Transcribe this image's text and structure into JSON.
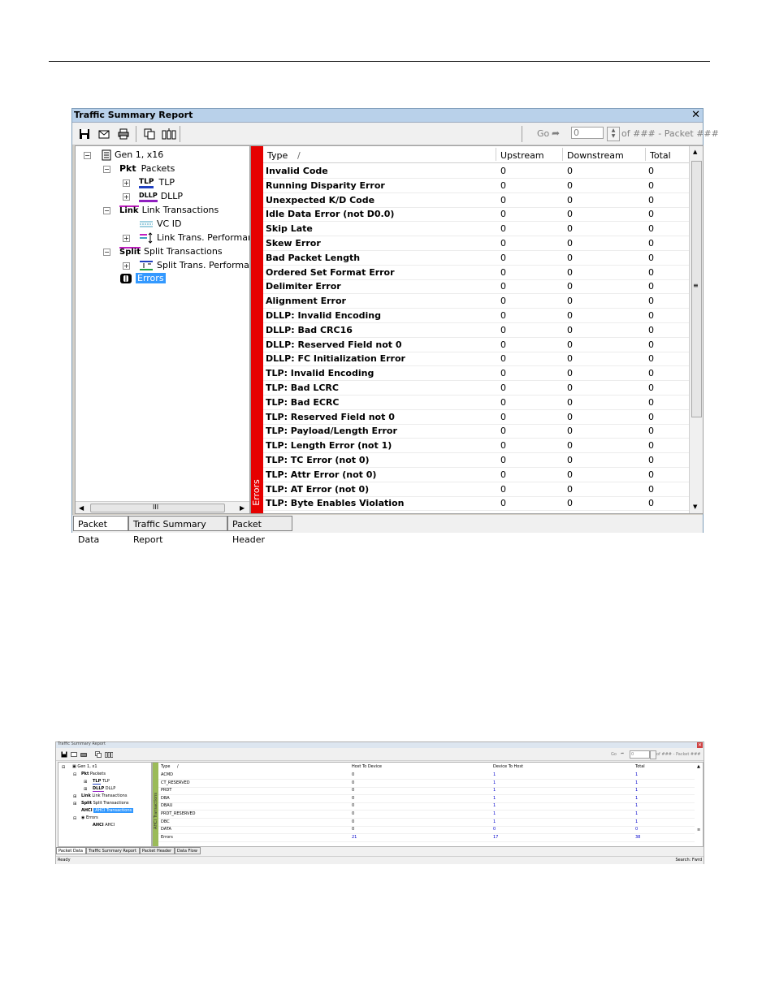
{
  "window1": {
    "title": "Traffic Summary Report",
    "close": "✕",
    "toolbar": {
      "go_label": "Go",
      "packet_input": "0",
      "of_label": "of ### - Packet ###"
    },
    "tree": {
      "root": "Gen 1, x16",
      "packets": "Packets",
      "packets_icon": "Pkt",
      "tlp": "TLP",
      "tlp_icon": "TLP",
      "dllp": "DLLP",
      "dllp_icon": "DLLP",
      "link_transactions": "Link Transactions",
      "link_icon": "Link",
      "vc_id": "VC ID",
      "link_trans_perf": "Link Trans. Performan",
      "split_transactions": "Split Transactions",
      "split_icon": "Split",
      "split_trans_perf": "Split Trans. Performan",
      "errors": "Errors"
    },
    "scroll_grip": "III",
    "grid": {
      "side_label": "Errors",
      "sort_indicator": "/",
      "columns": [
        "Type",
        "Upstream",
        "Downstream",
        "Total"
      ],
      "rows": [
        {
          "type": "Invalid Code",
          "up": "0",
          "down": "0",
          "total": "0"
        },
        {
          "type": "Running Disparity Error",
          "up": "0",
          "down": "0",
          "total": "0"
        },
        {
          "type": "Unexpected K/D Code",
          "up": "0",
          "down": "0",
          "total": "0"
        },
        {
          "type": "Idle Data Error (not D0.0)",
          "up": "0",
          "down": "0",
          "total": "0"
        },
        {
          "type": "Skip Late",
          "up": "0",
          "down": "0",
          "total": "0"
        },
        {
          "type": "Skew Error",
          "up": "0",
          "down": "0",
          "total": "0"
        },
        {
          "type": "Bad Packet Length",
          "up": "0",
          "down": "0",
          "total": "0"
        },
        {
          "type": "Ordered Set Format Error",
          "up": "0",
          "down": "0",
          "total": "0"
        },
        {
          "type": "Delimiter Error",
          "up": "0",
          "down": "0",
          "total": "0"
        },
        {
          "type": "Alignment Error",
          "up": "0",
          "down": "0",
          "total": "0"
        },
        {
          "type": "DLLP: Invalid Encoding",
          "up": "0",
          "down": "0",
          "total": "0"
        },
        {
          "type": "DLLP: Bad CRC16",
          "up": "0",
          "down": "0",
          "total": "0"
        },
        {
          "type": "DLLP: Reserved Field not 0",
          "up": "0",
          "down": "0",
          "total": "0"
        },
        {
          "type": "DLLP: FC Initialization Error",
          "up": "0",
          "down": "0",
          "total": "0"
        },
        {
          "type": "TLP: Invalid Encoding",
          "up": "0",
          "down": "0",
          "total": "0"
        },
        {
          "type": "TLP: Bad LCRC",
          "up": "0",
          "down": "0",
          "total": "0"
        },
        {
          "type": "TLP: Bad ECRC",
          "up": "0",
          "down": "0",
          "total": "0"
        },
        {
          "type": "TLP: Reserved Field not 0",
          "up": "0",
          "down": "0",
          "total": "0"
        },
        {
          "type": "TLP: Payload/Length Error",
          "up": "0",
          "down": "0",
          "total": "0"
        },
        {
          "type": "TLP: Length Error (not 1)",
          "up": "0",
          "down": "0",
          "total": "0"
        },
        {
          "type": "TLP: TC Error (not 0)",
          "up": "0",
          "down": "0",
          "total": "0"
        },
        {
          "type": "TLP: Attr Error (not 0)",
          "up": "0",
          "down": "0",
          "total": "0"
        },
        {
          "type": "TLP: AT Error (not 0)",
          "up": "0",
          "down": "0",
          "total": "0"
        },
        {
          "type": "TLP: Byte Enables Violation",
          "up": "0",
          "down": "0",
          "total": "0"
        }
      ]
    },
    "tabs": [
      "Packet Data",
      "Traffic Summary Report",
      "Packet Header"
    ]
  },
  "window2": {
    "title": "Traffic Summary Report",
    "toolbar": {
      "go_label": "Go",
      "packet_input": "0",
      "of_label": "of ### - Packet ###"
    },
    "tree": {
      "root": "Gen 1, x1",
      "packets": "Packets",
      "tlp": "TLP",
      "dllp": "DLLP",
      "link_transactions": "Link Transactions",
      "split_transactions": "Split Transactions",
      "ahci_transactions": "AHCI Transactions",
      "errors": "Errors",
      "ahci": "AHCI"
    },
    "grid": {
      "side_label": "AHCI Transactions",
      "sort_indicator": "/",
      "columns": [
        "Type",
        "Host To Device",
        "Device To Host",
        "Total"
      ],
      "rows": [
        {
          "type": "ACMD",
          "h2d": "0",
          "d2h": "1",
          "total": "1"
        },
        {
          "type": "CT_RESERVED",
          "h2d": "0",
          "d2h": "1",
          "total": "1"
        },
        {
          "type": "PRDT",
          "h2d": "0",
          "d2h": "1",
          "total": "1"
        },
        {
          "type": "DBA",
          "h2d": "0",
          "d2h": "1",
          "total": "1"
        },
        {
          "type": "DBAU",
          "h2d": "0",
          "d2h": "1",
          "total": "1"
        },
        {
          "type": "PRDT_RESERVED",
          "h2d": "0",
          "d2h": "1",
          "total": "1"
        },
        {
          "type": "DBC",
          "h2d": "0",
          "d2h": "1",
          "total": "1"
        },
        {
          "type": "DATA",
          "h2d": "0",
          "d2h": "0",
          "total": "0"
        },
        {
          "type": "Errors",
          "h2d": "21",
          "d2h": "17",
          "total": "38"
        }
      ]
    },
    "tabs": [
      "Packet Data",
      "Traffic Summary Report",
      "Packet Header",
      "Data Flow"
    ],
    "status_left": "Ready",
    "status_right": "Search: Fwrd"
  },
  "colors": {
    "errors_bar": "#e60000",
    "ahci_bar": "#9bbb59",
    "title_bar": "#b9d1ea",
    "selection": "#3399ff"
  }
}
